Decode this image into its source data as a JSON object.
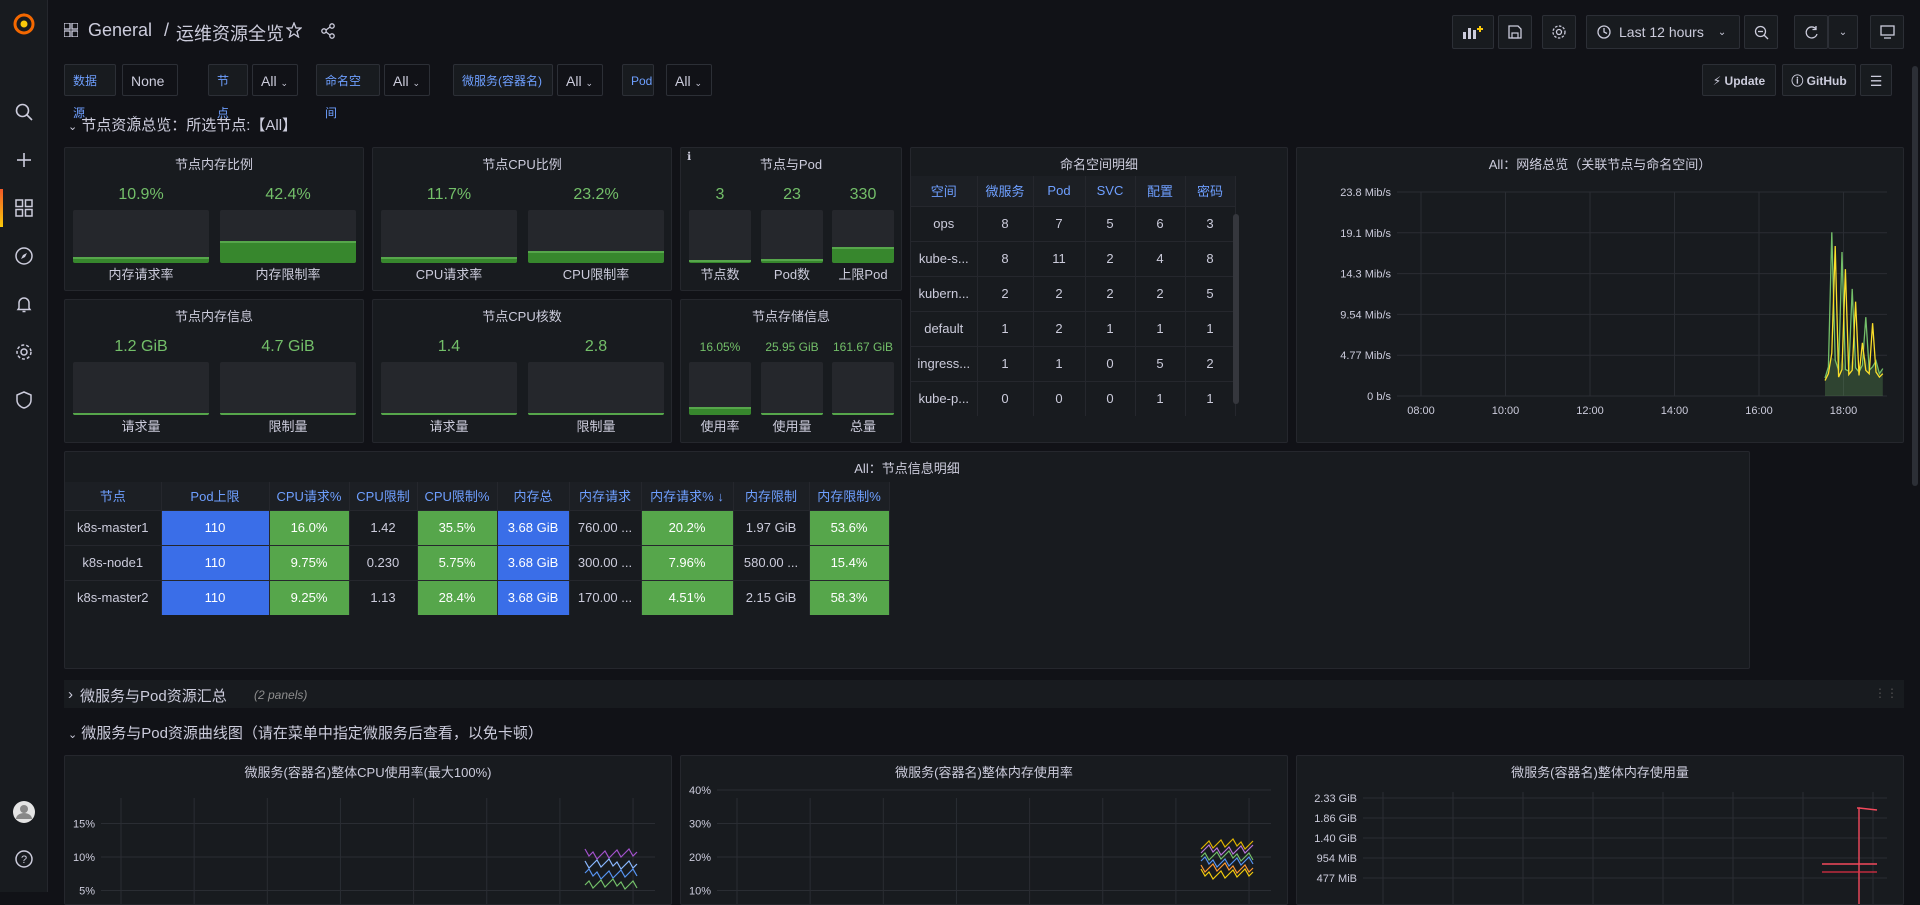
{
  "topbar": {
    "folder": "General",
    "separator": "/",
    "title": "运维资源全览",
    "time_range": "Last 12 hours"
  },
  "variables": [
    {
      "label": "数据源",
      "value": "None"
    },
    {
      "label": "节点",
      "value": "All"
    },
    {
      "label": "命名空间",
      "value": "All"
    },
    {
      "label": "微服务(容器名)",
      "value": "All"
    },
    {
      "label": "Pod",
      "value": "All"
    }
  ],
  "links": {
    "update": "Update",
    "github": "GitHub"
  },
  "rows": {
    "row1": "节点资源总览：所选节点:【All】",
    "row2": "微服务与Pod资源汇总",
    "row2_count": "(2 panels)",
    "row3": "微服务与Pod资源曲线图（请在菜单中指定微服务后查看，以免卡顿）"
  },
  "panels": {
    "mem_ratio": {
      "title": "节点内存比例",
      "g1_val": "10.9%",
      "g1_lbl": "内存请求率",
      "g1_pct": 10.9,
      "g2_val": "42.4%",
      "g2_lbl": "内存限制率",
      "g2_pct": 42.4
    },
    "cpu_ratio": {
      "title": "节点CPU比例",
      "g1_val": "11.7%",
      "g1_lbl": "CPU请求率",
      "g1_pct": 11.7,
      "g2_val": "23.2%",
      "g2_lbl": "CPU限制率",
      "g2_pct": 23.2
    },
    "node_pod": {
      "title": "节点与Pod",
      "g1_val": "3",
      "g1_lbl": "节点数",
      "g1_pct": 5,
      "g2_val": "23",
      "g2_lbl": "Pod数",
      "g2_pct": 7,
      "g3_val": "330",
      "g3_lbl": "上限Pod",
      "g3_pct": 30
    },
    "mem_info": {
      "title": "节点内存信息",
      "g1_val": "1.2 GiB",
      "g1_lbl": "请求量",
      "g1_pct": 3,
      "g2_val": "4.7 GiB",
      "g2_lbl": "限制量",
      "g2_pct": 3
    },
    "cpu_cores": {
      "title": "节点CPU核数",
      "g1_val": "1.4",
      "g1_lbl": "请求量",
      "g1_pct": 3,
      "g2_val": "2.8",
      "g2_lbl": "限制量",
      "g2_pct": 3
    },
    "storage": {
      "title": "节点存储信息",
      "g1_val": "16.05%",
      "g1_lbl": "使用率",
      "g1_pct": 16,
      "g2_val": "25.95 GiB",
      "g2_lbl": "使用量",
      "g2_pct": 3,
      "g3_val": "161.67 GiB",
      "g3_lbl": "总量",
      "g3_pct": 3
    },
    "namespace": {
      "title": "命名空间明细",
      "headers": [
        "空间",
        "微服务",
        "Pod",
        "SVC",
        "配置",
        "密码"
      ],
      "rows": [
        [
          "ops",
          "8",
          "7",
          "5",
          "6",
          "3"
        ],
        [
          "kube-s...",
          "8",
          "11",
          "2",
          "4",
          "8"
        ],
        [
          "kubern...",
          "2",
          "2",
          "2",
          "2",
          "5"
        ],
        [
          "default",
          "1",
          "2",
          "1",
          "1",
          "1"
        ],
        [
          "ingress...",
          "1",
          "1",
          "0",
          "5",
          "2"
        ],
        [
          "kube-p...",
          "0",
          "0",
          "0",
          "1",
          "1"
        ]
      ]
    },
    "network": {
      "title": "All：网络总览（关联节点与命名空间）"
    },
    "node_detail": {
      "title": "All：节点信息明细",
      "headers": [
        "节点",
        "Pod上限",
        "CPU请求%",
        "CPU限制",
        "CPU限制%",
        "内存总",
        "内存请求",
        "内存请求% ↓",
        "内存限制",
        "内存限制%"
      ],
      "rows": [
        [
          "k8s-master1",
          "110",
          "16.0%",
          "1.42",
          "35.5%",
          "3.68 GiB",
          "760.00 ...",
          "20.2%",
          "1.97 GiB",
          "53.6%"
        ],
        [
          "k8s-node1",
          "110",
          "9.75%",
          "0.230",
          "5.75%",
          "3.68 GiB",
          "300.00 ...",
          "7.96%",
          "580.00 ...",
          "15.4%"
        ],
        [
          "k8s-master2",
          "110",
          "9.25%",
          "1.13",
          "28.4%",
          "3.68 GiB",
          "170.00 ...",
          "4.51%",
          "2.15 GiB",
          "58.3%"
        ]
      ]
    },
    "ms_cpu": {
      "title": "微服务(容器名)整体CPU使用率(最大100%)"
    },
    "ms_mem_pct": {
      "title": "微服务(容器名)整体内存使用率"
    },
    "ms_mem_abs": {
      "title": "微服务(容器名)整体内存使用量"
    }
  },
  "chart_data": [
    {
      "type": "line",
      "title": "All：网络总览（关联节点与命名空间）",
      "x": [
        "08:00",
        "10:00",
        "12:00",
        "14:00",
        "16:00",
        "18:00"
      ],
      "y_ticks": [
        "0 b/s",
        "4.77 Mib/s",
        "9.54 Mib/s",
        "14.3 Mib/s",
        "19.1 Mib/s",
        "23.8 Mib/s"
      ],
      "ylim": [
        0,
        23.8
      ],
      "grid": true,
      "series": [
        {
          "color": "#73bf69",
          "values_note_start": "17:40",
          "peak": 19.1
        },
        {
          "color": "#fade2a",
          "values_note_start": "17:40",
          "peak": 17.5
        }
      ]
    },
    {
      "type": "line",
      "title": "微服务(容器名)整体CPU使用率(最大100%)",
      "y_ticks": [
        "5%",
        "10%",
        "15%"
      ],
      "grid": true
    },
    {
      "type": "line",
      "title": "微服务(容器名)整体内存使用率",
      "y_ticks": [
        "10%",
        "20%",
        "30%",
        "40%"
      ],
      "grid": true
    },
    {
      "type": "line",
      "title": "微服务(容器名)整体内存使用量",
      "y_ticks": [
        "477 MiB",
        "954 MiB",
        "1.40 GiB",
        "1.86 GiB",
        "2.33 GiB"
      ],
      "grid": true
    }
  ],
  "colors": {
    "accent_green": "#73bf69",
    "blue_cell": "#3a6ee8",
    "green_cell": "#56a64b",
    "link_blue": "#6e9fff"
  }
}
